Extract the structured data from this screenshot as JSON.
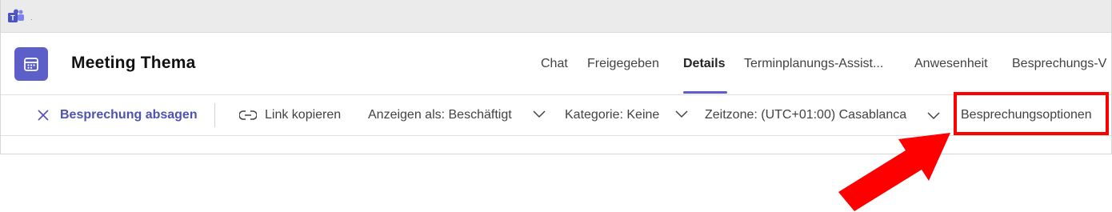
{
  "app": {
    "name": "Microsoft Teams",
    "logo_icon": "teams-logo-icon",
    "accent": "#5b5fc7"
  },
  "meeting": {
    "title": "Meeting Thema",
    "icon": "calendar-icon"
  },
  "tabs": [
    {
      "label": "Chat",
      "active": false
    },
    {
      "label": "Freigegeben",
      "active": false
    },
    {
      "label": "Details",
      "active": true
    },
    {
      "label": "Terminplanungs-Assist...",
      "active": false
    },
    {
      "label": "Anwesenheit",
      "active": false
    },
    {
      "label": "Besprechungs-V",
      "active": false
    }
  ],
  "toolbar": {
    "cancel_label": "Besprechung absagen",
    "copy_link_label": "Link kopieren",
    "show_as_label": "Anzeigen als: Beschäftigt",
    "category_label": "Kategorie: Keine",
    "timezone_label": "Zeitzone: (UTC+01:00) Casablanca",
    "options_label": "Besprechungsoptionen"
  },
  "annotation": {
    "highlight_color": "#ff0000"
  }
}
